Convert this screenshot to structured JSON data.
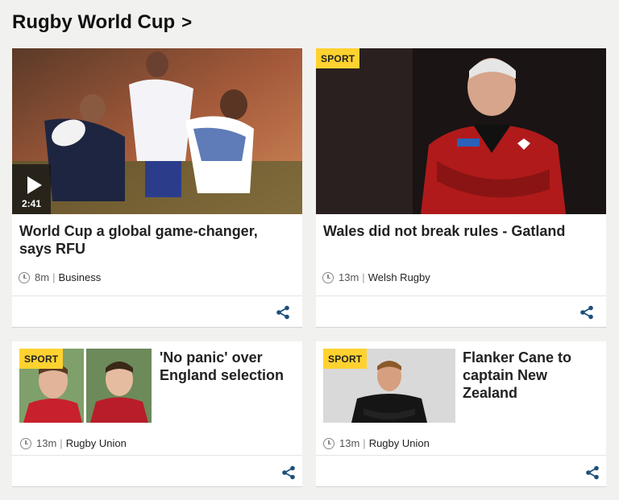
{
  "section": {
    "title": "Rugby World Cup",
    "chevron": ">"
  },
  "badge_label": "SPORT",
  "cards": [
    {
      "headline": "World Cup a global game-changer, says RFU",
      "time": "8m",
      "topic": "Business",
      "video_duration": "2:41"
    },
    {
      "headline": "Wales did not break rules - Gatland",
      "time": "13m",
      "topic": "Welsh Rugby",
      "badge": "SPORT"
    },
    {
      "headline": "'No panic' over England selection",
      "time": "13m",
      "topic": "Rugby Union",
      "badge": "SPORT"
    },
    {
      "headline": "Flanker Cane to captain New Zealand",
      "time": "13m",
      "topic": "Rugby Union",
      "badge": "SPORT"
    }
  ],
  "colors": {
    "badge": "#ffd230",
    "share_icon": "#1d4f7a",
    "background": "#f1f1ef"
  }
}
